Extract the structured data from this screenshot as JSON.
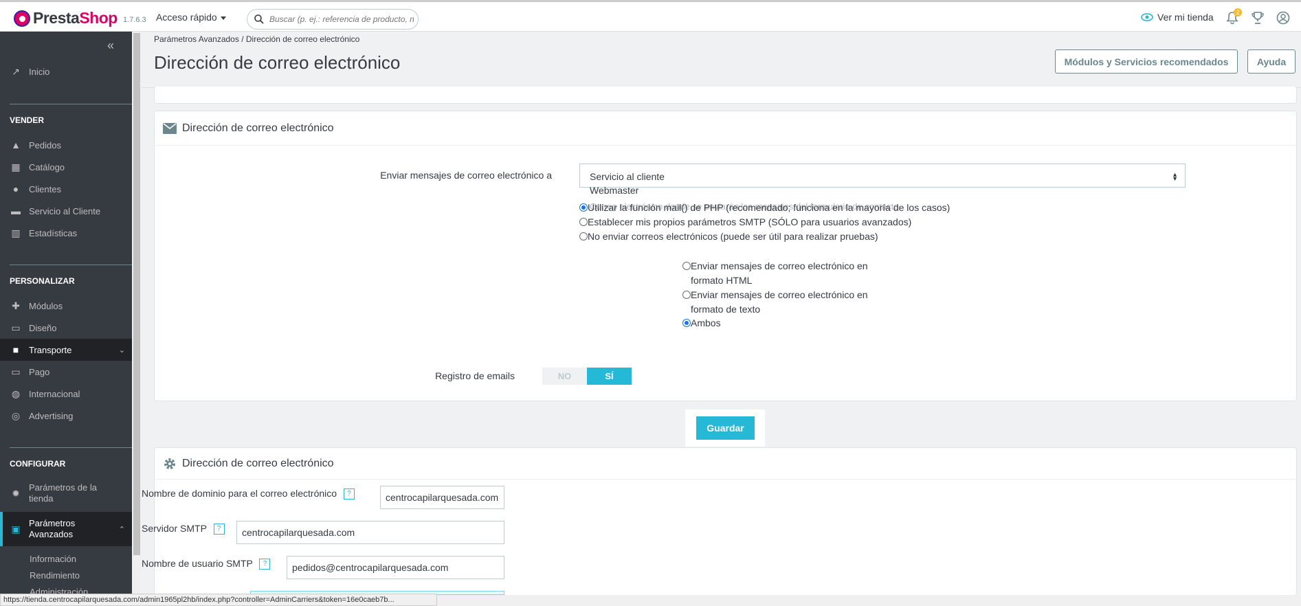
{
  "topbar": {
    "brand_a": "Presta",
    "brand_b": "Shop",
    "version": "1.7.6.3",
    "quick_access": "Acceso rápido",
    "search_placeholder": "Buscar (p. ej.: referencia de producto, nombre",
    "view_shop": "Ver mi tienda",
    "notifications_count": "2"
  },
  "sidebar": {
    "collapse": "«",
    "home": "Inicio",
    "sell_section": "VENDER",
    "sell_items": [
      "Pedidos",
      "Catálogo",
      "Clientes",
      "Servicio al Cliente",
      "Estadísticas"
    ],
    "customize_section": "PERSONALIZAR",
    "customize_items": [
      "Módulos",
      "Diseño",
      "Transporte",
      "Pago",
      "Internacional",
      "Advertising"
    ],
    "configure_section": "CONFIGURAR",
    "configure_items": [
      "Parámetros de la tienda",
      "Parámetros Avanzados"
    ],
    "sub_items": [
      "Información",
      "Rendimiento",
      "Administración"
    ]
  },
  "header": {
    "breadcrumb_parent": "Parámetros Avanzados",
    "breadcrumb_sep": "/",
    "breadcrumb_current": "Dirección de correo electrónico",
    "title": "Dirección de correo electrónico",
    "btn_modules": "Módulos y Servicios recomendados",
    "btn_help": "Ayuda"
  },
  "email_panel": {
    "title": "Dirección de correo electrónico",
    "send_to_label": "Enviar mensajes de correo electrónico a",
    "send_to_value": "Servicio al cliente",
    "send_to_option2": "Webmaster",
    "ghost_text": "Correo electrónico donde se enviarán los mensajes del formulario de contacto",
    "method_options": [
      "Utilizar la función mail() de PHP (recomendado; funciona en la mayoría de los casos)",
      "Establecer mis propios parámetros SMTP (SÓLO para usuarios avanzados)",
      "No enviar correos electrónicos (puede ser útil para realizar pruebas)"
    ],
    "format_options": [
      "Enviar mensajes de correo electrónico en formato HTML",
      "Enviar mensajes de correo electrónico en formato de texto",
      "Ambos"
    ],
    "log_label": "Registro de emails",
    "log_no": "NO",
    "log_yes": "SÍ",
    "save": "Guardar"
  },
  "smtp_panel": {
    "title": "Dirección de correo electrónico",
    "domain_label": "Nombre de dominio para el correo electrónico",
    "domain_value": "centrocapilarquesada.com",
    "server_label": "Servidor SMTP",
    "server_value": "centrocapilarquesada.com",
    "user_label": "Nombre de usuario SMTP",
    "user_value": "pedidos@centrocapilarquesada.com",
    "help_glyph": "?"
  },
  "statusbar": {
    "url": "https://tienda.centrocapilarquesada.com/admin1965pl2hb/index.php?controller=AdminCarriers&token=16e0caeb7b..."
  }
}
